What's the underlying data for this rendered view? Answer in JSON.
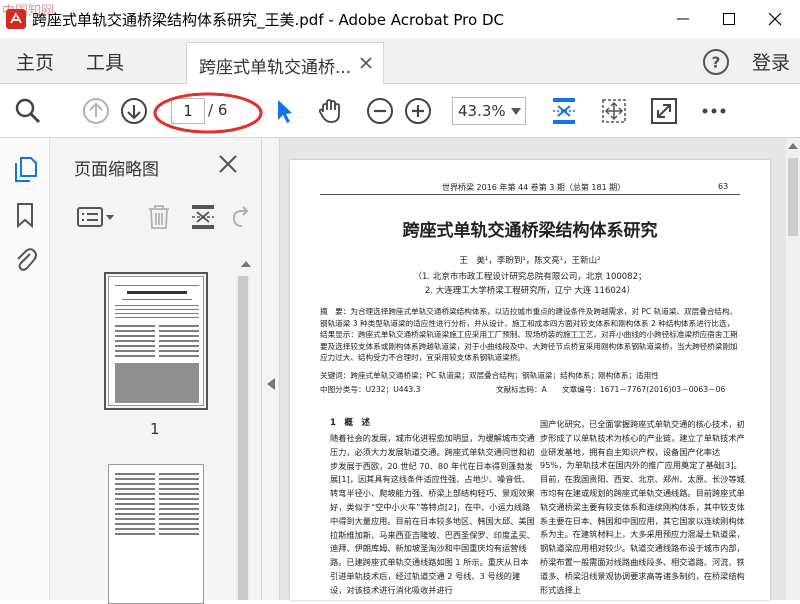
{
  "window": {
    "title": "跨座式单轨交通桥梁结构体系研究_王美.pdf - Adobe Acrobat Pro DC",
    "watermark": "中国知网"
  },
  "menu": {
    "home": "主页",
    "tools": "工具",
    "doc_tab": "跨座式单轨交通桥...",
    "signin": "登录"
  },
  "toolbar": {
    "current_page": "1",
    "total_pages": "/ 6",
    "zoom": "43.3%",
    "annotation_color": "#e03030",
    "accent": "#1473e6"
  },
  "panel": {
    "title": "页面缩略图",
    "thumbnails": [
      {
        "label": "1"
      }
    ]
  },
  "document": {
    "header_journal": "世界桥梁   2016 年第 44 卷第 3 期（总第 181 期）",
    "header_page": "63",
    "title": "跨座式单轨交通桥梁结构体系研究",
    "authors": "王　美¹，李盼到¹，陈文亮¹，王新山²",
    "affiliation1": "（1. 北京市市政工程设计研究总院有限公司，北京 100082；",
    "affiliation2": "2. 大连理工大学桥梁工程研究所，辽宁 大连 116024）",
    "abstract": "摘　要：为合理选择跨座式单轨交通桥梁结构体系，以迈拉城市重点的建设条件及跨越需求，对 PC 轨道梁、双层叠合结构、钢轨道梁 3 种类型轨道梁的适应性进行分析，并从设计、施工和成本四方面对较支体系和刚构体系 2 种结构体系进行比选，结果显示：跨座式单轨交通桥梁轨道梁施工应采用工厂预制、现场桥装的施工工艺，对弃小曲线的小跨径标准梁桥应宿舍工期要及选择较支体系或刚构体系跨越轨道梁，对于小曲线段及中、大跨径节点桥宜采用刚构体系钢轨道梁桥，当大跨径桥梁刚加应力过大、结构受力不合理时，宜采用较支体系钢轨道梁桥。",
    "keywords": "关键词：跨座式单轨交通桥梁；PC 轨道梁；双层叠合结构；钢轨道梁；结构体系；刚构体系；适用性",
    "classification": "中图分类号：U232；U443.3",
    "doc_code": "文献标志码：A",
    "article_id": "文章编号：1671－7767(2016)03－0063－06",
    "section1": "1　概　述",
    "col_left": "随着社会的发展，城市化进程愈加明显，为缓解城市交通压力，必须大力发展轨道交通。跨座式单轨交通问世和初步发展于西欧，20 世纪 70、80 年代在日本得到蓬勃发展[1]，因其具有这线条件适应性强、占地少、噪音低、转弯半径小、爬坡能力强、桥梁上部结构轻巧、景观效果好，类似于“空中小火车”等特点[2]，在中、小运力线路中得到大量应用。目前在日本较多地区、韩国大邱、美国拉斯维加斯、马来西亚吉隆坡、巴西圣保罗、印度孟买、迪拜、伊朗库姆、新加坡圣淘沙和中国重庆均有运营线路。已建跨座式单轨交通线路如图 1 所示。重庆从日本引进单轨技术后，经过轨道交通 2 号线、3 号线的建设，对该技术进行消化吸收并进行",
    "col_right": "国产化研究，已全面掌握跨座式单轨交通的核心技术，初步形成了以单轨技术为核心的产业链，建立了单轨技术产业研发基地，拥有自主知识产权，设备国产化率达 95%，为单轨技术在国内外的推广应用奠定了基础[3]。目前，在我国贵阳、西安、北京、郑州、太原、长沙等城市均有在建或规划的跨座式单轨交通线路。目前跨座式单轨交通桥梁主要有较支体系和连续刚构体系，其中较支体系主要在日本、韩国和中国应用，其它国家以连续刚构体系为主。在建筑材料上，大多采用预应力混凝土轨道梁，钢轨道梁应用相对较少。轨道交通线路布设于城市内部，桥梁布置一般需面对线路曲线段多、相交道路、河流、铁道多、桥梁沿线景观协调要求高等诸多制约，在桥梁结构形式选择上"
  }
}
